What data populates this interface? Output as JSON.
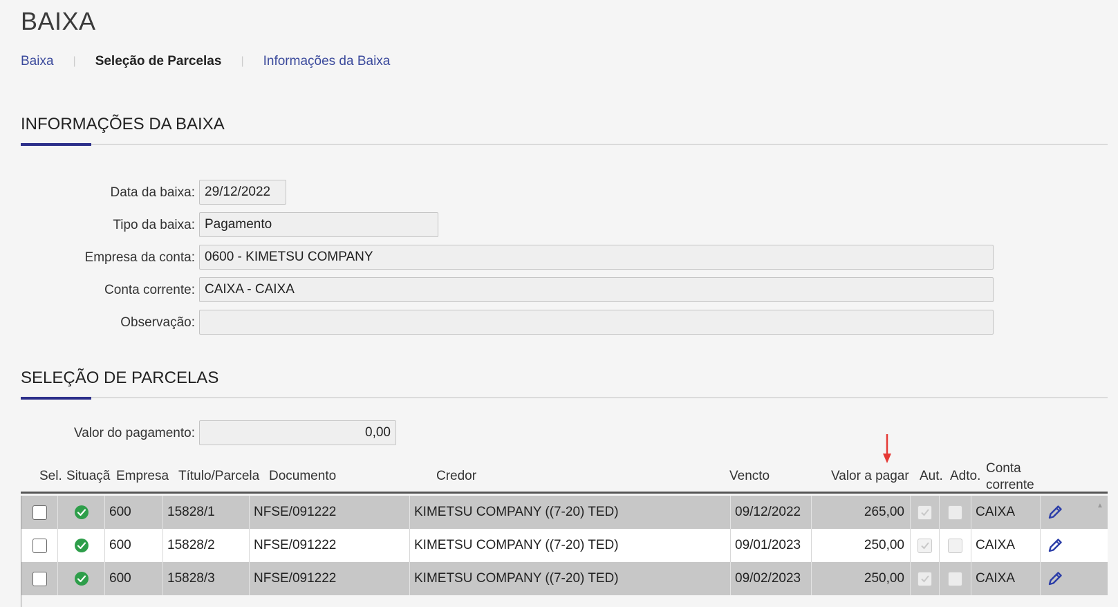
{
  "page": {
    "title": "BAIXA"
  },
  "breadcrumb": {
    "items": [
      {
        "label": "Baixa",
        "active": false
      },
      {
        "label": "Seleção de Parcelas",
        "active": true
      },
      {
        "label": "Informações da Baixa",
        "active": false
      }
    ],
    "separator": "|"
  },
  "info_section": {
    "title": "INFORMAÇÕES DA BAIXA",
    "fields": {
      "data_baixa": {
        "label": "Data da baixa:",
        "value": "29/12/2022"
      },
      "tipo_baixa": {
        "label": "Tipo da baixa:",
        "value": "Pagamento"
      },
      "empresa_conta": {
        "label": "Empresa da conta:",
        "value": "0600 - KIMETSU COMPANY"
      },
      "conta_corrente": {
        "label": "Conta corrente:",
        "value": "CAIXA - CAIXA"
      },
      "observacao": {
        "label": "Observação:",
        "value": ""
      }
    }
  },
  "parcelas_section": {
    "title": "SELEÇÃO DE PARCELAS",
    "valor_pagamento": {
      "label": "Valor do pagamento:",
      "value": "0,00"
    },
    "columns": {
      "sel": "Sel.",
      "situacao": "Situaçã",
      "empresa": "Empresa",
      "titulo": "Título/Parcela",
      "documento": "Documento",
      "credor": "Credor",
      "vencto": "Vencto",
      "valor": "Valor a pagar",
      "aut": "Aut.",
      "adto": "Adto.",
      "conta_line1": "Conta",
      "conta_line2": "corrente"
    },
    "sort_indicator_color": "#e53935",
    "rows": [
      {
        "empresa": "600",
        "titulo": "15828/1",
        "documento": "NFSE/091222",
        "credor": "KIMETSU COMPANY ((7-20) TED)",
        "vencto": "09/12/2022",
        "valor": "265,00",
        "conta": "CAIXA",
        "status": "ok-icon"
      },
      {
        "empresa": "600",
        "titulo": "15828/2",
        "documento": "NFSE/091222",
        "credor": "KIMETSU COMPANY ((7-20) TED)",
        "vencto": "09/01/2023",
        "valor": "250,00",
        "conta": "CAIXA",
        "status": "ok-icon"
      },
      {
        "empresa": "600",
        "titulo": "15828/3",
        "documento": "NFSE/091222",
        "credor": "KIMETSU COMPANY ((7-20) TED)",
        "vencto": "09/02/2023",
        "valor": "250,00",
        "conta": "CAIXA",
        "status": "ok-icon"
      }
    ]
  },
  "colors": {
    "accent": "#2c2f8a",
    "link": "#3b4a9c",
    "status_ok": "#2e9e4a",
    "edit_icon": "#2c3ea8",
    "row_alt": "#c7c7c7"
  }
}
